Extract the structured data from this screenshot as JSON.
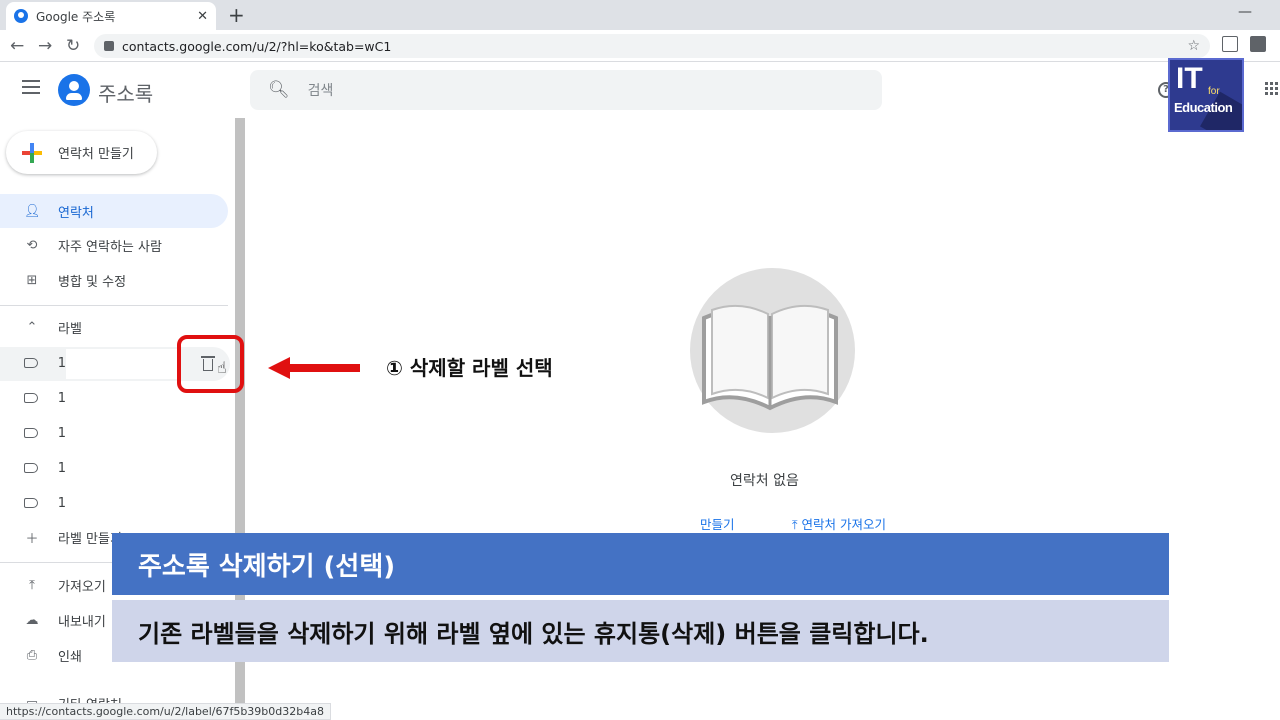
{
  "browser": {
    "tab_title": "Google 주소록",
    "tab_close": "✕",
    "new_tab": "+",
    "url": "contacts.google.com/u/2/?hl=ko&tab=wC1",
    "status_url": "https://contacts.google.com/u/2/label/67f5b39b0d32b4a8"
  },
  "header": {
    "app_title": "주소록",
    "search_placeholder": "검색"
  },
  "logo": {
    "it": "IT",
    "for": "for",
    "edu": "Education"
  },
  "sidebar": {
    "create_label": "연락처 만들기",
    "items": [
      {
        "label": "연락처"
      },
      {
        "label": "자주 연락하는 사람"
      },
      {
        "label": "병합 및 수정"
      }
    ],
    "labels_header": "라벨",
    "label_rows": [
      "1",
      "1",
      "1",
      "1",
      "1"
    ],
    "create_label_item": "라벨 만들기",
    "import": "가져오기",
    "export": "내보내기",
    "print": "인쇄",
    "other": "기타 연락처"
  },
  "annotation": "① 삭제할 라벨 선택",
  "empty_state": {
    "text": "연락처 없음",
    "link1": "만들기",
    "link2": "연락처 가져오기"
  },
  "caption": {
    "title": "주소록 삭제하기 (선택)",
    "body": "기존 라벨들을 삭제하기 위해 라벨 옆에 있는 휴지통(삭제) 버튼을 클릭합니다."
  },
  "colors": {
    "accent": "#1a73e8",
    "highlight": "#e01010",
    "banner_title": "#4472c4",
    "banner_body": "#cfd5ea"
  }
}
